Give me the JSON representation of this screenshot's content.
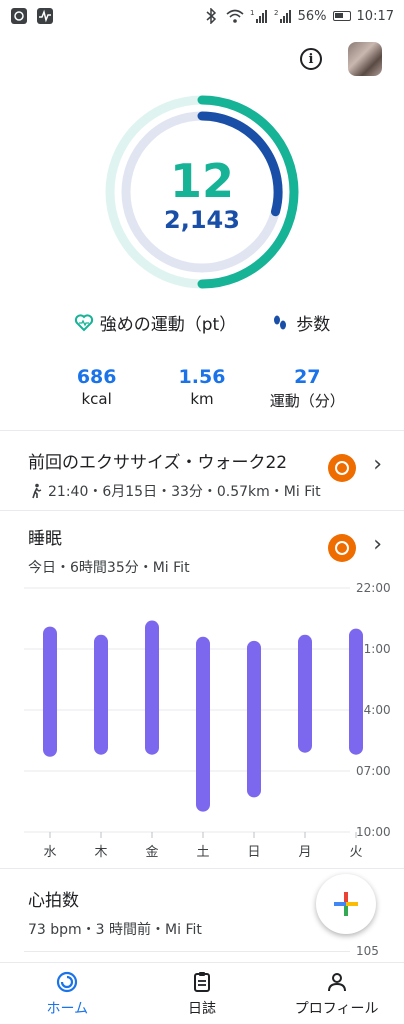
{
  "status": {
    "battery": "56%",
    "time": "10:17",
    "left_icons": [
      "mi-fit-icon",
      "activity-icon"
    ],
    "right_icons": [
      "bluetooth-icon",
      "wifi-icon",
      "signal-1-icon",
      "signal-2-icon",
      "battery-icon"
    ],
    "sim1": "1",
    "sim2": "2"
  },
  "rings": {
    "heart_points": "12",
    "steps": "2,143",
    "heart_color": "#17b397",
    "steps_color": "#1a4fa8"
  },
  "legend": {
    "heart_label": "強めの運動（pt）",
    "steps_label": "歩数"
  },
  "stats": [
    {
      "value": "686",
      "label": "kcal"
    },
    {
      "value": "1.56",
      "label": "km"
    },
    {
      "value": "27",
      "label": "運動（分）"
    }
  ],
  "exercise": {
    "title": "前回のエクササイズ・ウォーク22",
    "details": "21:40・6月15日・33分・0.57km・Mi Fit"
  },
  "sleep": {
    "title": "睡眠",
    "details": "今日・6時間35分・Mi Fit"
  },
  "chart_data": {
    "type": "bar",
    "categories": [
      "水",
      "木",
      "金",
      "土",
      "日",
      "月",
      "火"
    ],
    "y_ticks": [
      "22:00",
      "01:00",
      "04:00",
      "07:00",
      "10:00"
    ],
    "sleep_start_hours_after_22": [
      1.9,
      2.3,
      1.6,
      2.4,
      2.6,
      2.3,
      2.0
    ],
    "sleep_end_hours_after_22": [
      8.3,
      8.2,
      8.2,
      11.0,
      10.3,
      8.1,
      8.2
    ],
    "bar_color": "#7b68ee",
    "ylim": [
      0,
      12
    ]
  },
  "heart_rate": {
    "title": "心拍数",
    "details": "73 bpm・3 時間前・Mi Fit",
    "axis_label": "105"
  },
  "nav": {
    "home": "ホーム",
    "journal": "日誌",
    "profile": "プロフィール"
  }
}
